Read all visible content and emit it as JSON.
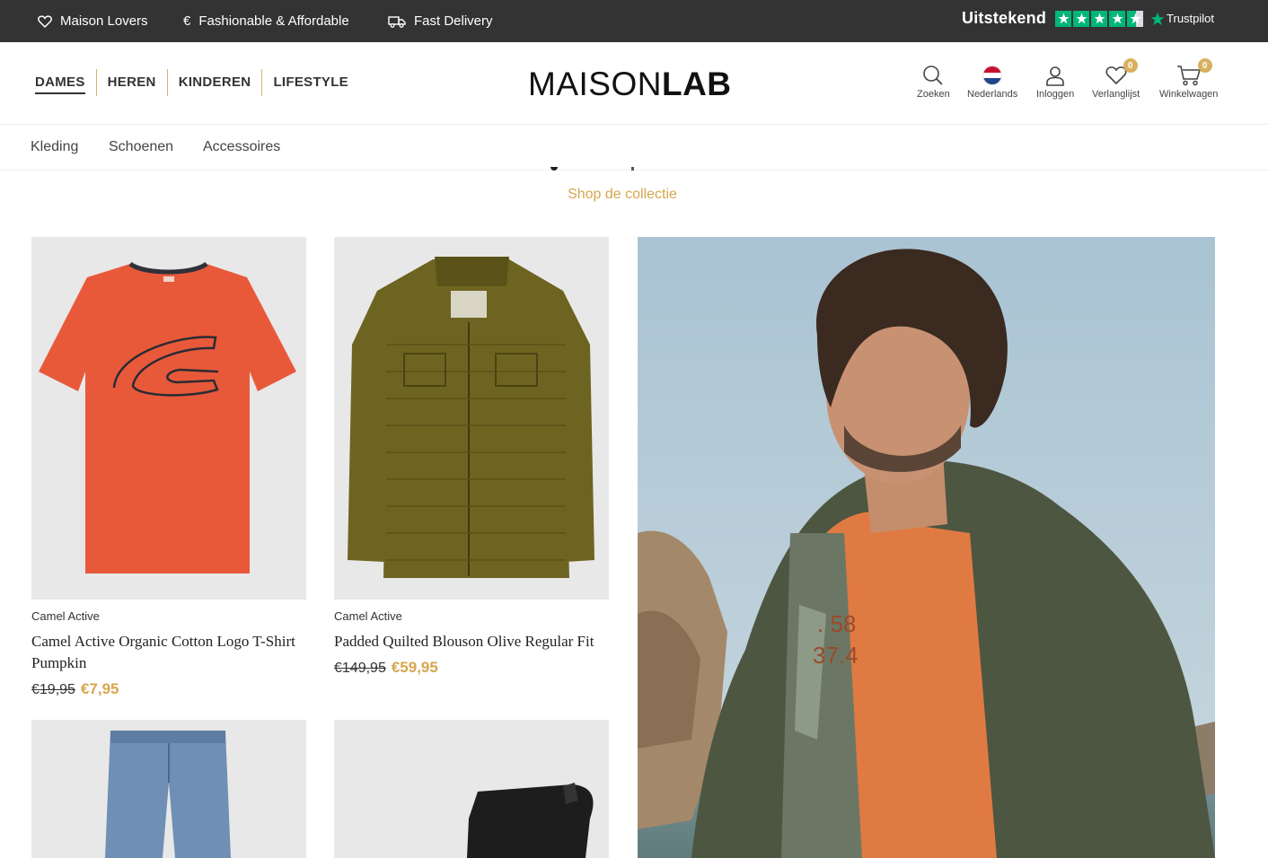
{
  "topbar": {
    "usps": [
      "Maison Lovers",
      "Fashionable & Affordable",
      "Fast Delivery"
    ],
    "usp_icons": [
      "heart-icon",
      "euro-icon",
      "truck-icon"
    ],
    "trustpilot": {
      "rating_label": "Uitstekend",
      "brand": "Trustpilot",
      "stars": 4.5
    }
  },
  "header": {
    "nav": [
      "DAMES",
      "HEREN",
      "KINDEREN",
      "LIFESTYLE"
    ],
    "active_nav": "DAMES",
    "logo": {
      "part1": "MAISON",
      "part2": "LAB"
    },
    "utilities": {
      "search": "Zoeken",
      "language": "Nederlands",
      "login": "Inloggen",
      "wishlist": "Verlanglijst",
      "wishlist_count": "0",
      "cart": "Winkelwagen",
      "cart_count": "0"
    }
  },
  "subnav": [
    "Kleding",
    "Schoenen",
    "Accessoires"
  ],
  "cta": "Shop de collectie",
  "products": [
    {
      "brand": "Camel Active",
      "title": "Camel Active Organic Cotton Logo T-Shirt Pumpkin",
      "old_price": "€19,95",
      "new_price": "€7,95"
    },
    {
      "brand": "Camel Active",
      "title": "Padded Quilted Blouson Olive Regular Fit",
      "old_price": "€149,95",
      "new_price": "€59,95"
    }
  ],
  "colors": {
    "topbar": "#333333",
    "accent": "#d6a64e",
    "trustpilot_green": "#00b67a"
  }
}
